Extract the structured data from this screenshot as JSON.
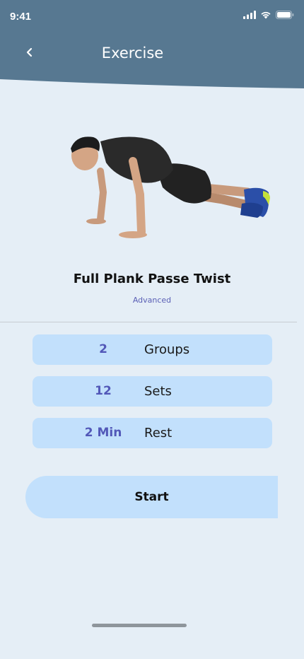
{
  "status_bar": {
    "time": "9:41"
  },
  "header": {
    "title": "Exercise",
    "back_icon": "chevron-left-icon",
    "color": "#577891"
  },
  "exercise": {
    "name": "Full Plank Passe Twist",
    "level": "Advanced"
  },
  "stats": [
    {
      "value": "2",
      "label": "Groups"
    },
    {
      "value": "12",
      "label": "Sets"
    },
    {
      "value": "2 Min",
      "label": "Rest"
    }
  ],
  "actions": {
    "start_label": "Start"
  },
  "colors": {
    "background": "#e5eef6",
    "accent": "#5258b8",
    "card": "#c2e0fc"
  }
}
